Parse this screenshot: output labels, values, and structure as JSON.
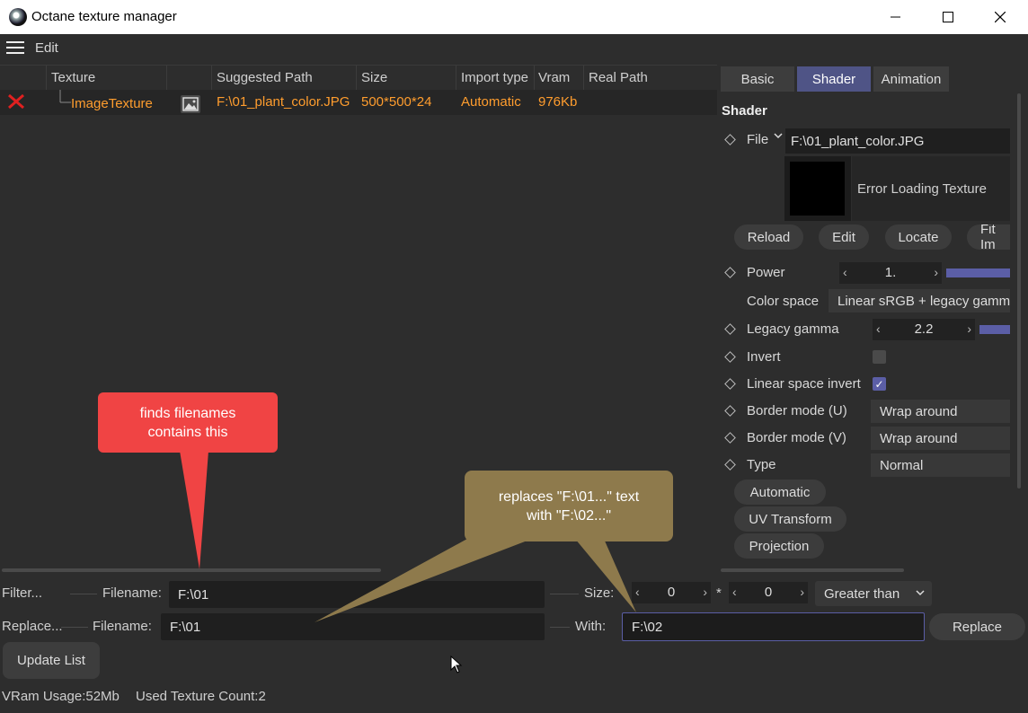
{
  "window": {
    "title": "Octane texture manager"
  },
  "menu": {
    "edit_label": "Edit"
  },
  "table": {
    "columns": [
      "Texture",
      "Suggested Path",
      "Size",
      "Import type",
      "Vram",
      "Real Path"
    ],
    "rows": [
      {
        "texture": "ImageTexture",
        "suggested_path": "F:\\01_plant_color.JPG",
        "size": "500*500*24",
        "import_type": "Automatic",
        "vram": "976Kb",
        "real_path": ""
      }
    ]
  },
  "panel": {
    "tabs": [
      "Basic",
      "Shader",
      "Animation"
    ],
    "active_tab": "Shader",
    "section_title": "Shader",
    "file": {
      "label": "File",
      "value": "F:\\01_plant_color.JPG",
      "preview_message": "Error Loading Texture"
    },
    "file_buttons": [
      "Reload",
      "Edit",
      "Locate",
      "Fit Im"
    ],
    "power": {
      "label": "Power",
      "value": "1."
    },
    "color_space": {
      "label": "Color space",
      "value": "Linear sRGB + legacy gamma"
    },
    "legacy_gamma": {
      "label": "Legacy gamma",
      "value": "2.2"
    },
    "invert": {
      "label": "Invert",
      "checked": false
    },
    "linear_space_invert": {
      "label": "Linear space invert",
      "checked": true
    },
    "border_u": {
      "label": "Border mode (U)",
      "value": "Wrap around"
    },
    "border_v": {
      "label": "Border mode (V)",
      "value": "Wrap around"
    },
    "type": {
      "label": "Type",
      "value": "Normal"
    },
    "sub_buttons": [
      "Automatic",
      "UV Transform",
      "Projection"
    ]
  },
  "filter": {
    "label": "Filter...",
    "filename_label": "Filename:",
    "filename_value": "F:\\01",
    "size_label": "Size:",
    "size_w": "0",
    "size_sep": "*",
    "size_h": "0",
    "compare": "Greater than"
  },
  "replace": {
    "label": "Replace...",
    "filename_label": "Filename:",
    "filename_value": "F:\\01",
    "with_label": "With:",
    "with_value": "F:\\02",
    "button": "Replace"
  },
  "update_button": "Update List",
  "status": {
    "vram": "VRam Usage:52Mb",
    "count": "Used Texture Count:2"
  },
  "callouts": {
    "filter_note": "finds filenames contains this",
    "replace_note": "replaces \"F:\\01...\" text with \"F:\\02...\""
  },
  "colors": {
    "accent": "#5b5ea6",
    "highlight_text": "#ff9d2e",
    "error_icon": "#e02020",
    "callout_red": "#f04444",
    "callout_olive": "#8e7a4c"
  }
}
